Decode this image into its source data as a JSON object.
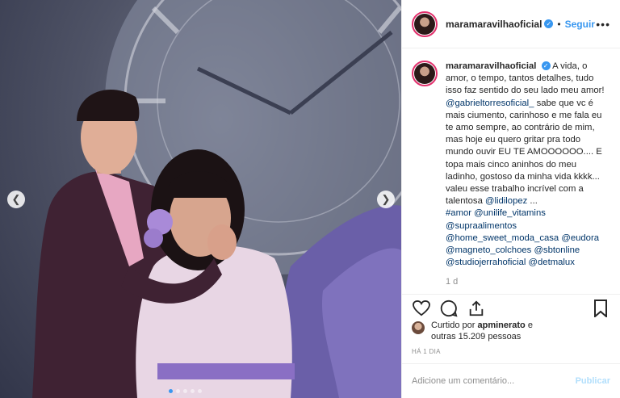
{
  "post": {
    "photo_alt": "",
    "dots_count": 5
  },
  "header": {
    "username": "maramaravilhaoficial",
    "separator": "•",
    "follow_label": "Seguir",
    "more": "•••"
  },
  "caption": {
    "username": "maramaravilhaoficial",
    "text_1": "A vida, o amor, o tempo, tantos detalhes, tudo isso faz sentido do seu lado meu amor! ",
    "mention_1": "@gabrieltorresoficial_",
    "text_2": " sabe que vc é mais ciumento, carinhoso e me fala eu te amo sempre, ao contrário de mim, mas hoje eu quero gritar pra todo mundo ouvir EU TE AMOOOOOO.... E topa mais cinco aninhos do meu ladinho, gostoso da minha vida kkkk... valeu esse trabalho incrível com a talentosa ",
    "mention_2": "@lidilopez",
    "text_3": " ...",
    "tags": [
      "#amor",
      "@unilife_vitamins",
      "@supraalimentos",
      "@home_sweet_moda_casa",
      "@eudora",
      "@magneto_colchoes",
      "@sbtonline",
      "@studiojerrahoficial",
      "@detmalux"
    ],
    "time": "1 d"
  },
  "likes": {
    "text_prefix": "Curtido por ",
    "liker": "apminerato",
    "text_mid": " e",
    "others": "outras 15.209 pessoas",
    "ago": "HÁ 1 DIA"
  },
  "comment_box": {
    "placeholder": "Adicione um comentário...",
    "publish_label": "Publicar"
  },
  "colors": {
    "link_blue": "#3897f0",
    "mention_blue": "#003569",
    "muted": "#8e8e8e"
  }
}
